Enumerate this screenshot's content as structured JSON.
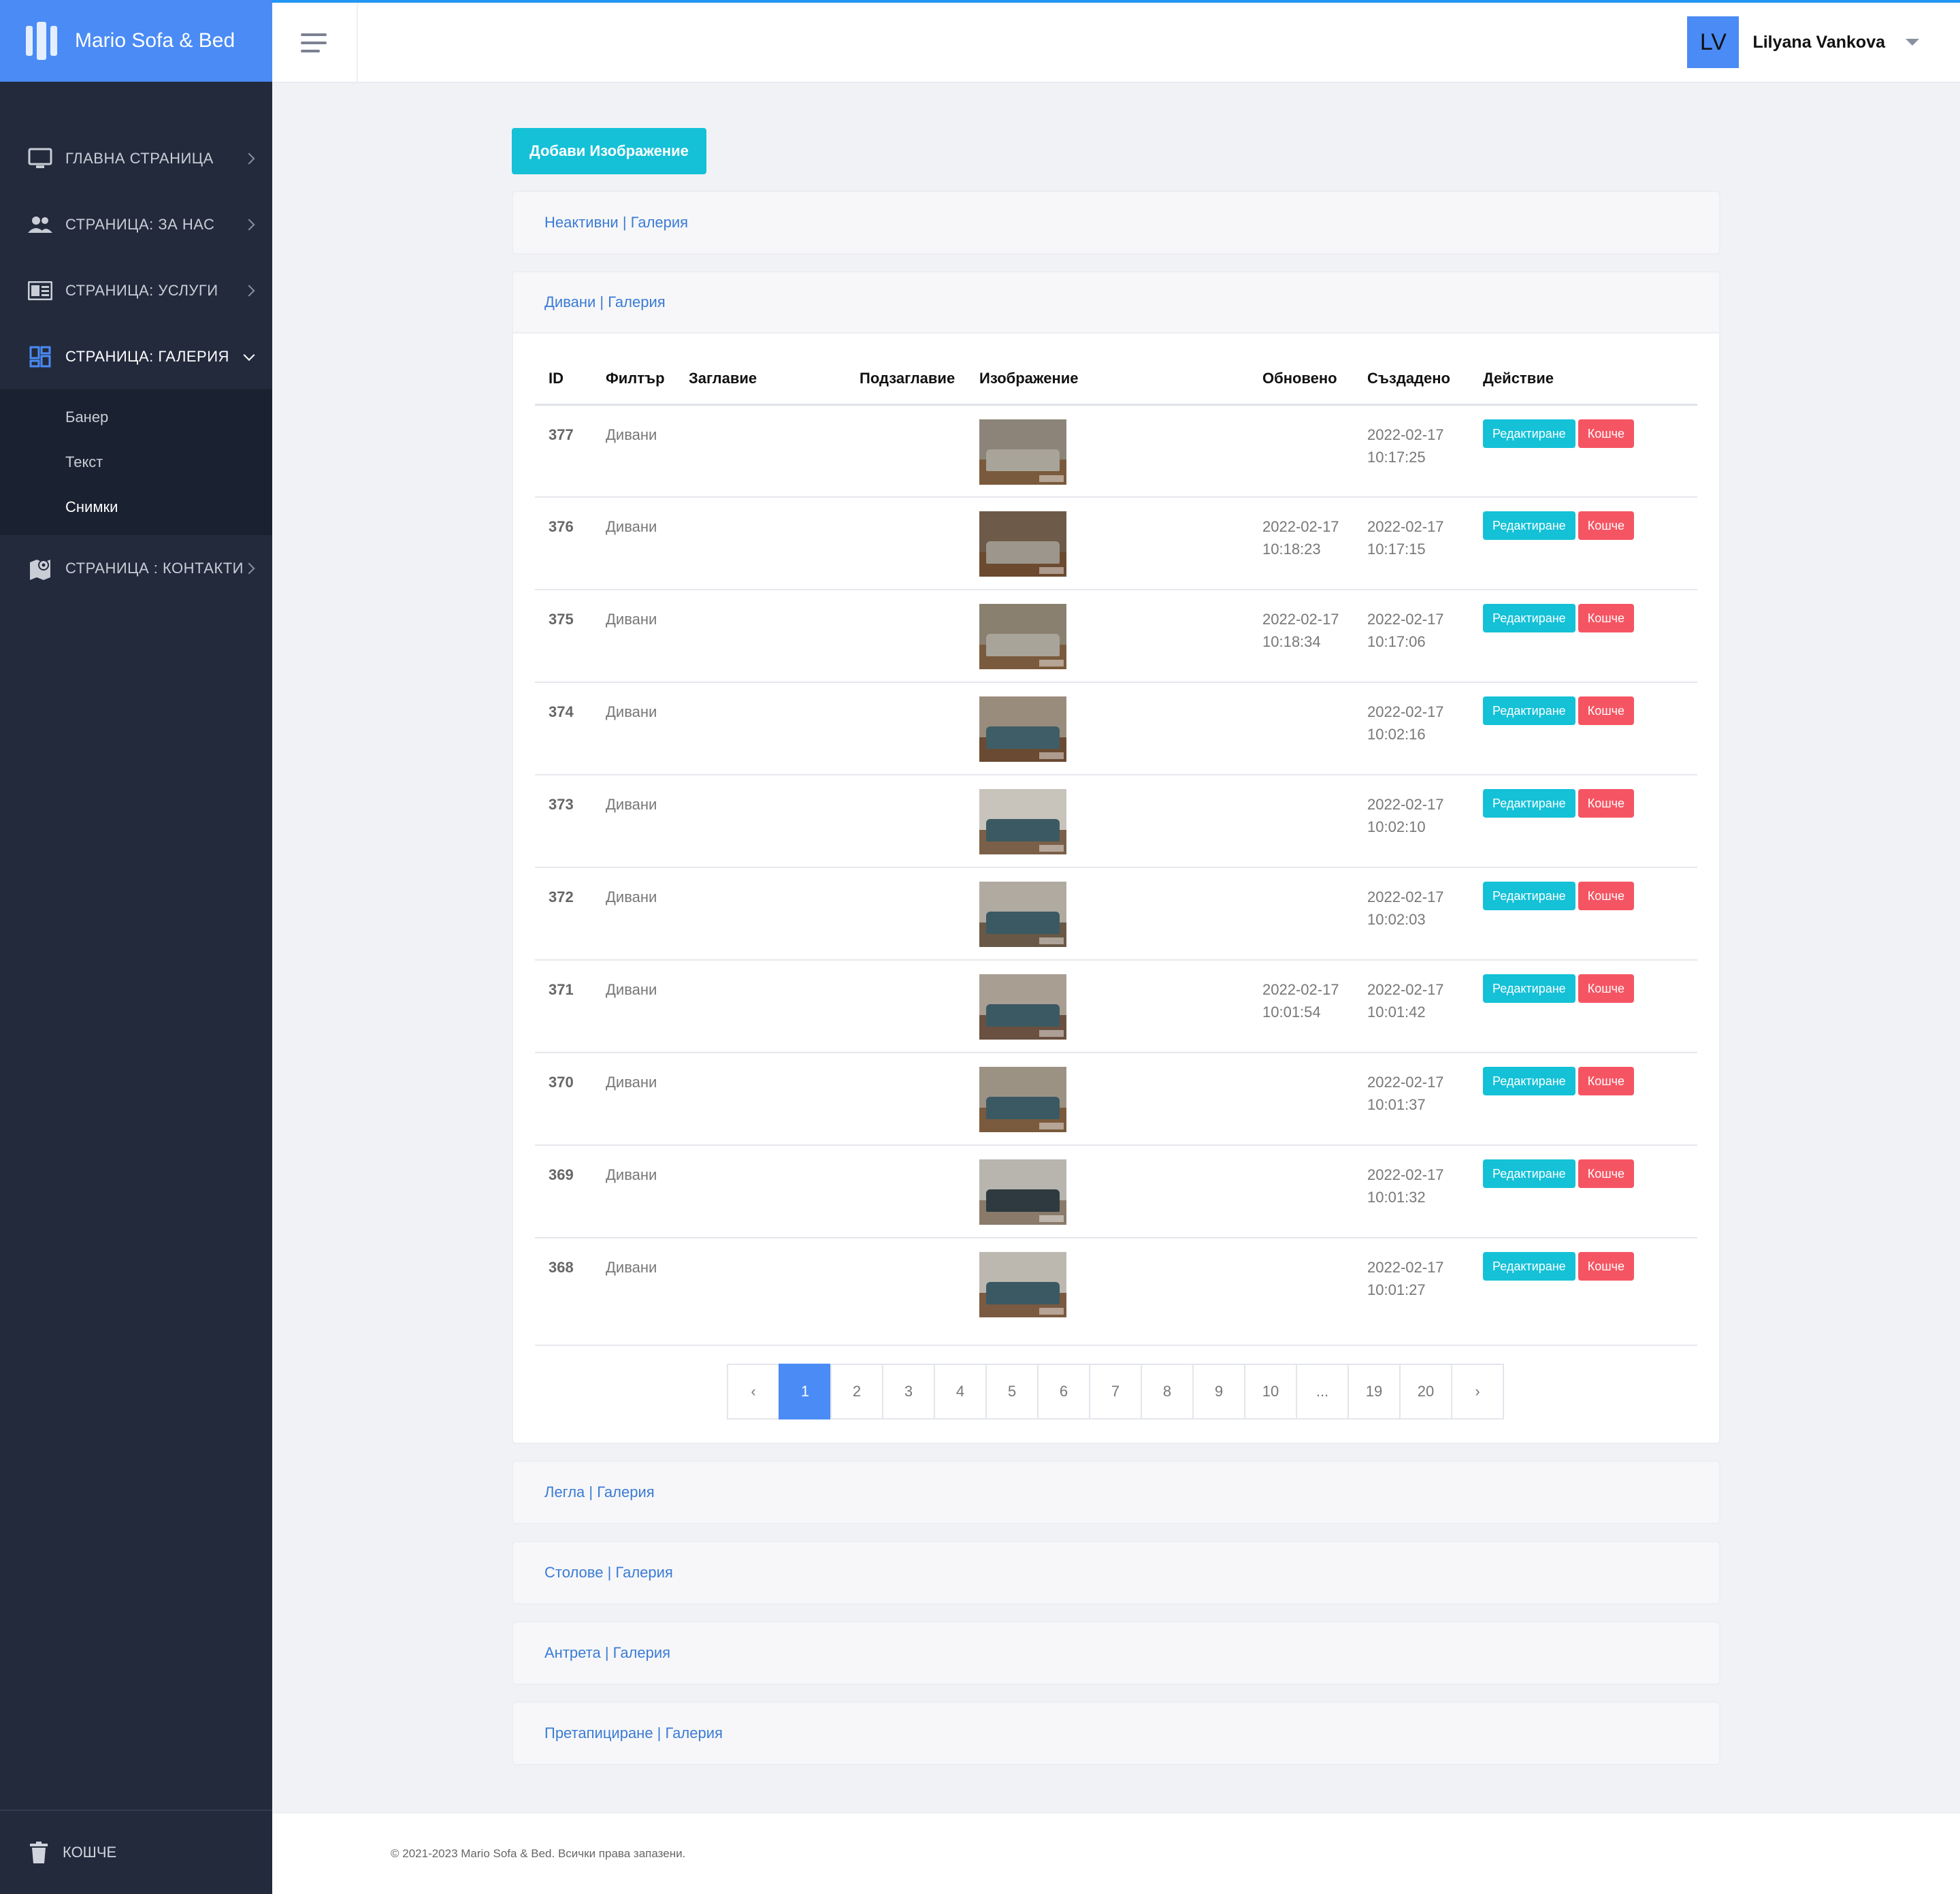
{
  "brand": {
    "name": "Mario Sofa & Bed"
  },
  "user": {
    "initials": "LV",
    "name": "Lilyana Vankova"
  },
  "sidebar": {
    "items": [
      {
        "label": "ГЛАВНА СТРАНИЦА",
        "icon": "monitor-icon"
      },
      {
        "label": "СТРАНИЦА: ЗА НАС",
        "icon": "people-icon"
      },
      {
        "label": "СТРАНИЦА: УСЛУГИ",
        "icon": "card-icon"
      },
      {
        "label": "СТРАНИЦА: ГАЛЕРИЯ",
        "icon": "dashboard-icon"
      },
      {
        "label": "СТРАНИЦА : КОНТАКТИ",
        "icon": "map-pin-icon"
      }
    ],
    "submenu": [
      "Банер",
      "Текст",
      "Снимки"
    ],
    "trash_label": "КОШЧЕ"
  },
  "main": {
    "add_button": "Добави Изображение",
    "panels": {
      "inactive": "Неактивни | Галерия",
      "sofas": "Дивани | Галерия",
      "beds": "Легла | Галерия",
      "chairs": "Столове | Галерия",
      "halls": "Антрета | Галерия",
      "upholstery": "Претапициране | Галерия"
    },
    "table": {
      "headers": [
        "ID",
        "Филтър",
        "Заглавие",
        "Подзаглавие",
        "Изображение",
        "Обновено",
        "Създадено",
        "Действие"
      ],
      "edit_label": "Редактиране",
      "delete_label": "Кошче",
      "rows": [
        {
          "id": "377",
          "filter": "Дивани",
          "updated_date": "",
          "updated_time": "",
          "created_date": "2022-02-17",
          "created_time": "10:17:25"
        },
        {
          "id": "376",
          "filter": "Дивани",
          "updated_date": "2022-02-17",
          "updated_time": "10:18:23",
          "created_date": "2022-02-17",
          "created_time": "10:17:15"
        },
        {
          "id": "375",
          "filter": "Дивани",
          "updated_date": "2022-02-17",
          "updated_time": "10:18:34",
          "created_date": "2022-02-17",
          "created_time": "10:17:06"
        },
        {
          "id": "374",
          "filter": "Дивани",
          "updated_date": "",
          "updated_time": "",
          "created_date": "2022-02-17",
          "created_time": "10:02:16"
        },
        {
          "id": "373",
          "filter": "Дивани",
          "updated_date": "",
          "updated_time": "",
          "created_date": "2022-02-17",
          "created_time": "10:02:10"
        },
        {
          "id": "372",
          "filter": "Дивани",
          "updated_date": "",
          "updated_time": "",
          "created_date": "2022-02-17",
          "created_time": "10:02:03"
        },
        {
          "id": "371",
          "filter": "Дивани",
          "updated_date": "2022-02-17",
          "updated_time": "10:01:54",
          "created_date": "2022-02-17",
          "created_time": "10:01:42"
        },
        {
          "id": "370",
          "filter": "Дивани",
          "updated_date": "",
          "updated_time": "",
          "created_date": "2022-02-17",
          "created_time": "10:01:37"
        },
        {
          "id": "369",
          "filter": "Дивани",
          "updated_date": "",
          "updated_time": "",
          "created_date": "2022-02-17",
          "created_time": "10:01:32"
        },
        {
          "id": "368",
          "filter": "Дивани",
          "updated_date": "",
          "updated_time": "",
          "created_date": "2022-02-17",
          "created_time": "10:01:27"
        }
      ]
    },
    "pagination": [
      "‹",
      "1",
      "2",
      "3",
      "4",
      "5",
      "6",
      "7",
      "8",
      "9",
      "10",
      "...",
      "19",
      "20",
      "›"
    ],
    "current_page": "1"
  },
  "footer": {
    "text": "© 2021-2023 Mario Sofa & Bed. Всички права запазени."
  },
  "colors": {
    "accent": "#4a8bf5",
    "edit": "#14c1d7",
    "delete": "#f55563",
    "sidebar": "#222a3c",
    "link": "#3a7bd5"
  }
}
